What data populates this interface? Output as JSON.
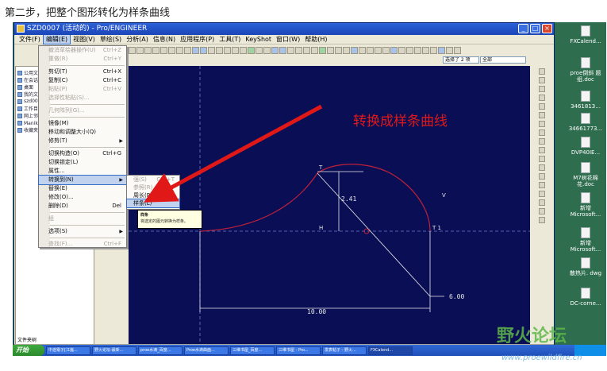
{
  "caption": "第二步，把整个图形转化为样条曲线",
  "window": {
    "title": "SZD0007 (活动的) - Pro/ENGINEER",
    "controls": {
      "minimize": "_",
      "maximize": "□",
      "close": "×"
    }
  },
  "menubar": [
    "文件(F)",
    "编辑(E)",
    "视图(V)",
    "草绘(S)",
    "分析(A)",
    "信息(N)",
    "应用程序(P)",
    "工具(T)",
    "KeyShot",
    "窗口(W)",
    "帮助(H)"
  ],
  "toolbar_select": {
    "left": "选择了 2 项",
    "right": "全部"
  },
  "edit_menu": {
    "items": [
      {
        "label": "撤消草绘器操作(U)",
        "shortcut": "Ctrl+Z",
        "disabled": true
      },
      {
        "label": "重做(R)",
        "shortcut": "Ctrl+Y",
        "disabled": true
      },
      {
        "label": "剪切(T)",
        "shortcut": "Ctrl+X"
      },
      {
        "label": "复制(C)",
        "shortcut": "Ctrl+C"
      },
      {
        "label": "粘贴(P)",
        "shortcut": "Ctrl+V",
        "disabled": true
      },
      {
        "label": "选择性粘贴(S)...",
        "disabled": true
      },
      {
        "label": "几何阵列(G)...",
        "disabled": true
      },
      {
        "label": "镜像(M)"
      },
      {
        "label": "移动和调整大小(Q)"
      },
      {
        "label": "修剪(T)",
        "submenu": true
      },
      {
        "label": "切换构造(O)",
        "shortcut": "Ctrl+G"
      },
      {
        "label": "切换锁定(L)"
      },
      {
        "label": "属性..."
      },
      {
        "label": "转换到(N)",
        "submenu": true,
        "highlighted": true
      },
      {
        "label": "替换(E)"
      },
      {
        "label": "修改(O)..."
      },
      {
        "label": "删除(D)",
        "shortcut": "Del"
      },
      {
        "label": "组",
        "disabled": true
      },
      {
        "label": "选项(S)",
        "submenu": true
      },
      {
        "label": "查找(F)...",
        "shortcut": "Ctrl+F",
        "disabled": true
      }
    ]
  },
  "convert_submenu": {
    "items": [
      {
        "label": "强(S)",
        "shortcut": "Ctrl+T",
        "disabled": true
      },
      {
        "label": "参照(R)",
        "disabled": true
      },
      {
        "label": "周长(P)"
      },
      {
        "label": "样条(L)",
        "highlighted": true
      }
    ]
  },
  "tooltip": {
    "title": "样条",
    "text": "将选定的图元转换为样条。"
  },
  "annotation": "转换成样条曲线",
  "dimensions": {
    "d1": "2.41",
    "d2": "6.00",
    "d3": "10.00"
  },
  "sketch_labels": {
    "h": "H",
    "v": "V",
    "t1": "T",
    "t2": "T 1",
    "tv": "T",
    "v2": "V"
  },
  "left_panel": {
    "items": [
      "公用文件夹",
      "在会话中",
      "桌面",
      "我的文档",
      "szd0007",
      "工作目录",
      "网上邻居",
      "Manikin 库",
      "收藏夹"
    ],
    "footer": "文件夹树"
  },
  "desktop_icons": [
    "FXCalend...",
    "proe倒斜\n题组.doc",
    "3461813...",
    "34661773...",
    "DVP40IE...",
    "M7树花棉\n花.doc",
    "新增\nMicrosoft...",
    "新增\nMicrosoft...",
    "散热片.\ndwg",
    "DC-corne..."
  ],
  "taskbar": {
    "start": "开始",
    "tasks": [
      "中途電子[江嵐...",
      "野火论坛-最新...",
      "proe水滴_百度...",
      "Proe水滴曲面...",
      "三维书屋_百度...",
      "三维书屋 - Pro...",
      "发表帖子 - 野火...",
      "FXCalend..."
    ]
  },
  "watermark": {
    "text": "野火论坛",
    "url": "www.proewildfire.cn"
  },
  "colors": {
    "canvas": "#0a0f55",
    "curve": "#c0203a",
    "arrow": "#e01818",
    "annotation": "#e01818",
    "dim": "#e8e8e8",
    "titlebar": "#1c46b8"
  }
}
